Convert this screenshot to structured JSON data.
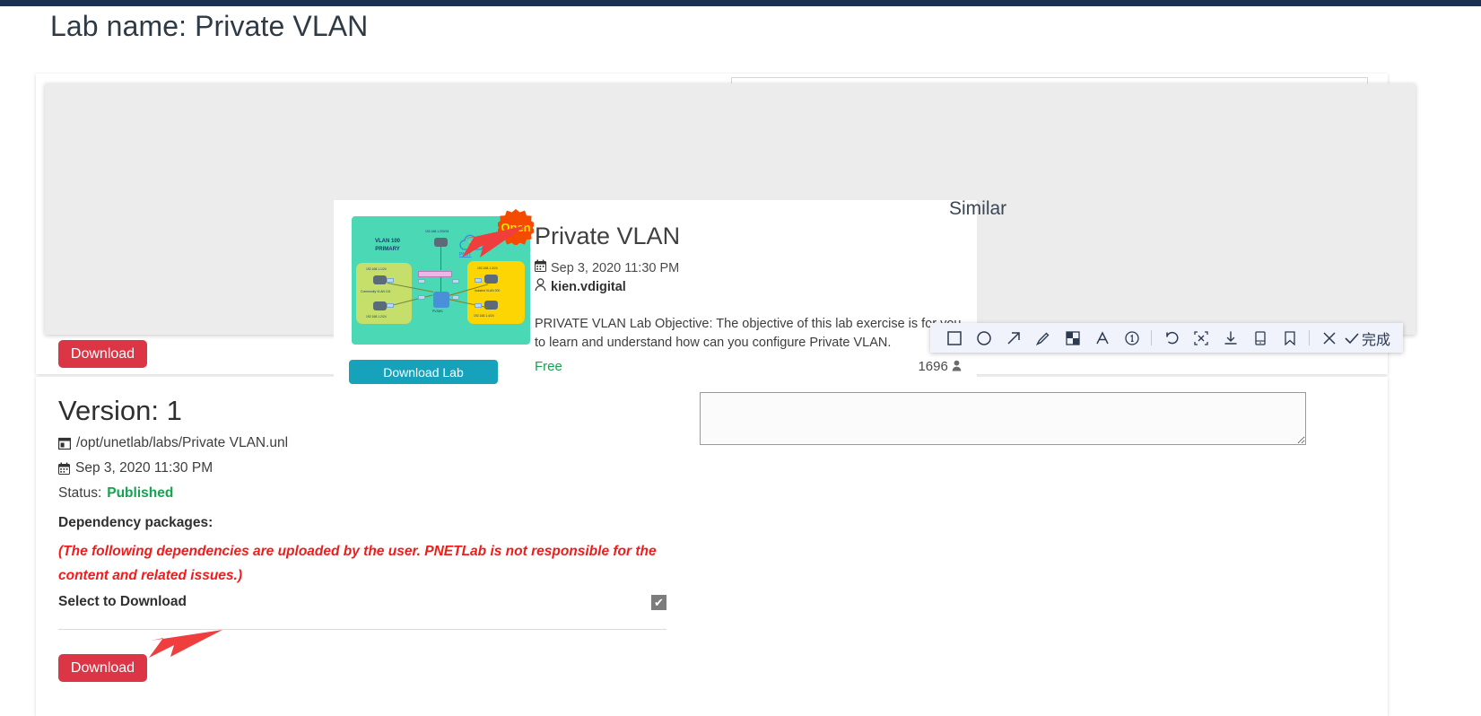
{
  "page": {
    "title": "Lab name: Private VLAN"
  },
  "lab_card": {
    "badge": "Open",
    "title": "Private VLAN",
    "date": "Sep 3, 2020 11:30 PM",
    "author": "kien.vdigital",
    "description": "PRIVATE VLAN Lab Objective: The objective of this lab exercise is for you to learn and understand how can you configure Private VLAN.",
    "price": "Free",
    "download_count": "1696",
    "download_lab_label": "Download Lab",
    "icons": {
      "calendar": "calendar-icon",
      "user": "user-icon",
      "downloads": "user-count-icon"
    },
    "thumbnail": {
      "vlan_label_line1": "VLAN 100",
      "vlan_label_line2": "PRIMARY",
      "pnet_label": "PNET",
      "top_ip": "192.168.1.200/24",
      "left_ip_top": "192.168.1.1/24",
      "left_label": "Community VLAN 101",
      "left_ip_bottom": "192.168.1.2/24",
      "right_ip_top": "192.168.1.3/24",
      "right_label": "Isolated VLAN 200",
      "right_ip_bottom": "192.168.1.4/24",
      "trunk_label": "Trunk 802.1Q",
      "switch_label": "PVSW1"
    }
  },
  "similar": {
    "title": "Similar"
  },
  "buttons": {
    "download_top": "Download",
    "download_bottom": "Download"
  },
  "capture_toolbar": {
    "items": [
      {
        "name": "rectangle-tool-icon",
        "label": "Rectangle"
      },
      {
        "name": "ellipse-tool-icon",
        "label": "Ellipse"
      },
      {
        "name": "arrow-tool-icon",
        "label": "Arrow"
      },
      {
        "name": "pencil-tool-icon",
        "label": "Pencil"
      },
      {
        "name": "mosaic-tool-icon",
        "label": "Mosaic"
      },
      {
        "name": "text-tool-icon",
        "label": "Text"
      },
      {
        "name": "serial-number-tool-icon",
        "label": "Serial number"
      },
      {
        "name": "undo-icon",
        "label": "Undo"
      },
      {
        "name": "ocr-extract-text-icon",
        "label": "Extract text"
      },
      {
        "name": "download-icon",
        "label": "Save"
      },
      {
        "name": "send-to-phone-icon",
        "label": "Send to phone"
      },
      {
        "name": "pin-screenshot-icon",
        "label": "Pin"
      },
      {
        "name": "close-icon",
        "label": "Cancel"
      },
      {
        "name": "confirm-check-icon",
        "label": "Confirm"
      }
    ],
    "done_label": "完成"
  },
  "version": {
    "heading": "Version: 1",
    "file_path": "/opt/unetlab/labs/Private VLAN.unl",
    "date": "Sep 3, 2020 11:30 PM",
    "status_label": "Status:",
    "status_value": "Published",
    "dependency_title": "Dependency packages:",
    "dependency_note": "(The following dependencies are uploaded by the user. PNETLab is not responsible for the content and related issues.)",
    "select_label": "Select to Download",
    "checkbox_checked": "✔"
  },
  "note": {
    "value": "",
    "placeholder": ""
  },
  "colors": {
    "topbar": "#1c3050",
    "download_red": "#dc3545",
    "download_lab_teal": "#17a2bb",
    "status_green": "#17a252",
    "warning_red": "#f01c1c",
    "badge_orange": "#f44b00",
    "badge_text_yellow": "#ffe600",
    "overlay_grey": "#ececec",
    "arrow_red": "#f03e3e"
  }
}
